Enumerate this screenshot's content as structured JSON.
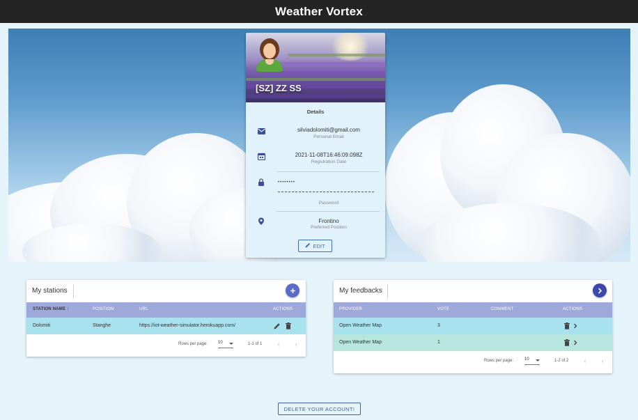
{
  "app": {
    "title": "Weather Vortex"
  },
  "profile": {
    "name": "[SZ] ZZ SS",
    "details_title": "Details",
    "email": {
      "value": "silviadolomiti@gmail.com",
      "label": "Personal Email"
    },
    "registration": {
      "value": "2021-11-08T16:46:09.098Z",
      "label": "Registration Date"
    },
    "password": {
      "value": "••••••••",
      "label": "Password"
    },
    "position": {
      "value": "Frontino",
      "label": "Preferred Position"
    },
    "edit_label": "EDIT"
  },
  "stations": {
    "title": "My stations",
    "columns": [
      "STATION NAME",
      "POSITION",
      "URL",
      "ACTIONS"
    ],
    "sort_indicator": "↑",
    "rows": [
      {
        "name": "Dolomiti",
        "position": "Stanghe",
        "url": "https://iot-weather-simulator.herokuapp.com/"
      }
    ],
    "footer": {
      "rows_per_page_label": "Rows per page:",
      "rows_per_page": "10",
      "range": "1-1 of 1"
    }
  },
  "feedbacks": {
    "title": "My feedbacks",
    "columns": [
      "PROVIDER",
      "VOTE",
      "COMMENT",
      "ACTIONS"
    ],
    "rows": [
      {
        "provider": "Open Weather Map",
        "vote": "3",
        "comment": ""
      },
      {
        "provider": "Open Weather Map",
        "vote": "1",
        "comment": ""
      }
    ],
    "footer": {
      "rows_per_page_label": "Rows per page:",
      "rows_per_page": "10",
      "range": "1-2 of 2"
    }
  },
  "delete_account_label": "DELETE YOUR ACCOUNT!",
  "colors": {
    "topbar": "#242424",
    "background": "#e5f3fb",
    "table_header": "#9fa8da",
    "row_highlight": "#a8e2ef",
    "row_alt": "#b6e6dd",
    "fab": "#5b6bc9",
    "fab_dark": "#3a48b0",
    "accent": "#3f5fa8"
  },
  "icons": [
    "email-icon",
    "calendar-icon",
    "lock-icon",
    "location-pin-icon",
    "pencil-icon",
    "delete-icon",
    "chevron-right-icon",
    "plus-icon",
    "arrow-up-icon"
  ]
}
